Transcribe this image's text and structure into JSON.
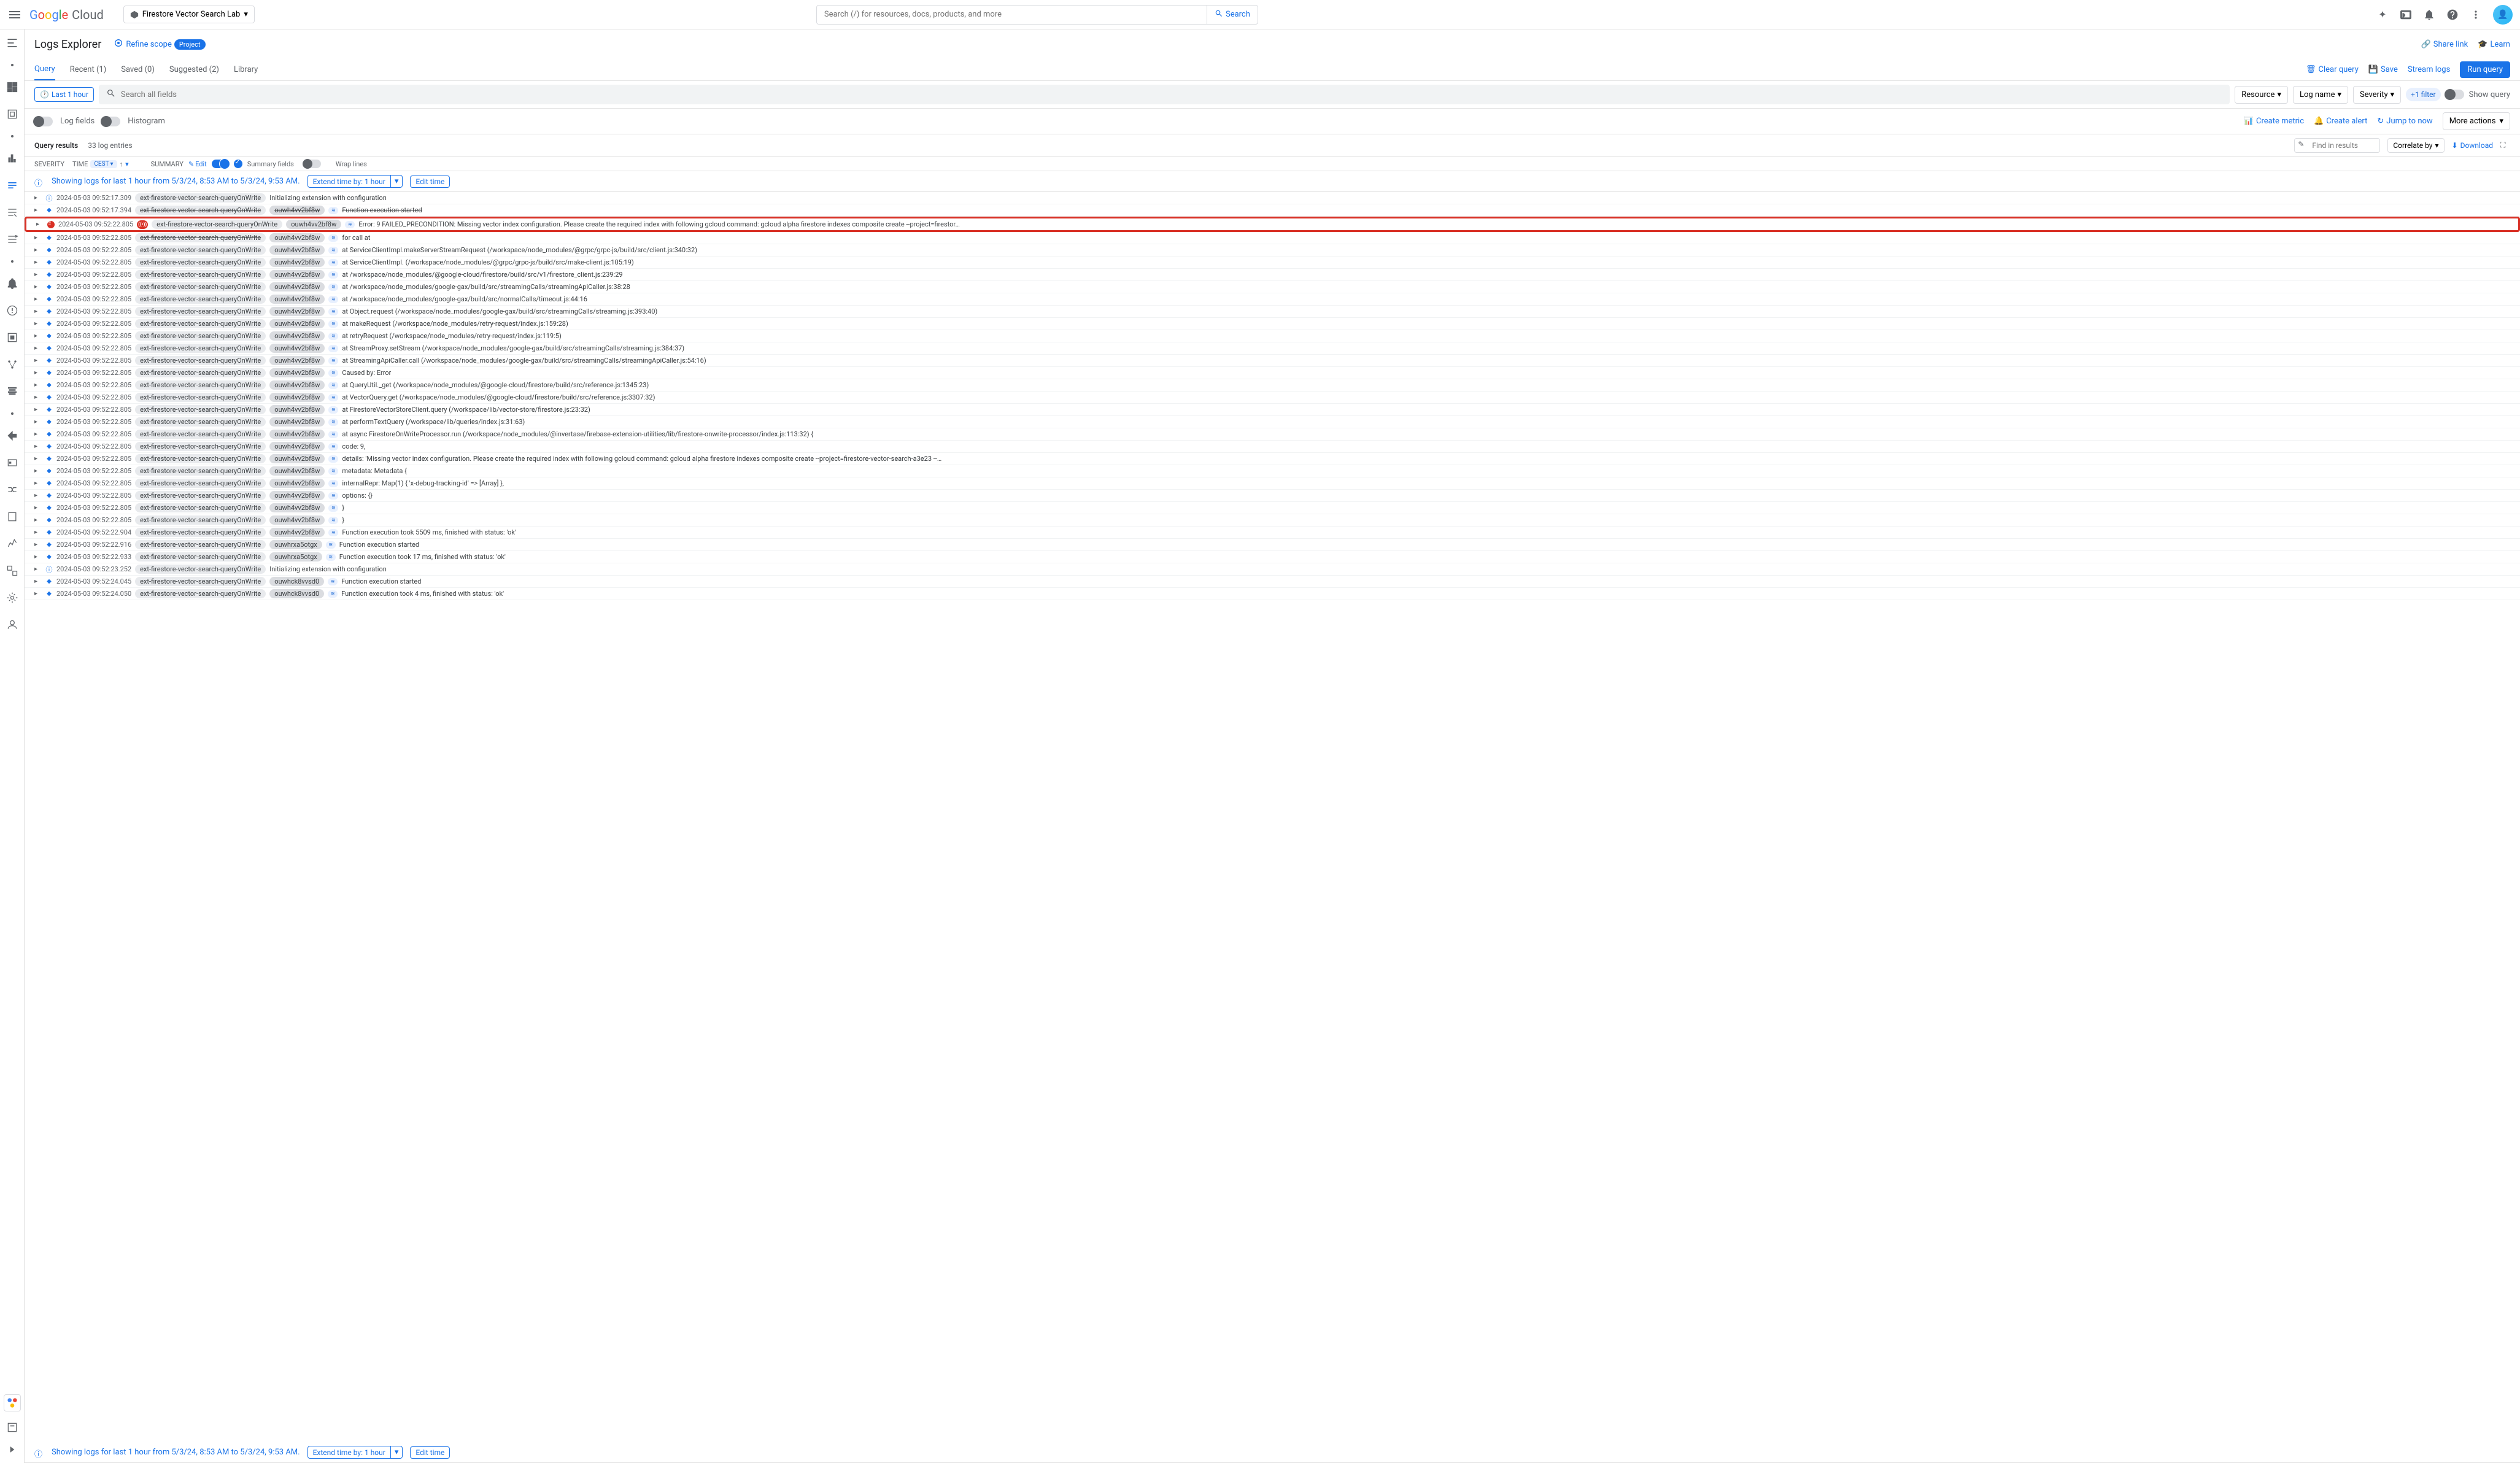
{
  "header": {
    "logo_cloud": "Cloud",
    "project_name": "Firestore Vector Search Lab",
    "search_placeholder": "Search (/) for resources, docs, products, and more",
    "search_button": "Search"
  },
  "title_bar": {
    "page_title": "Logs Explorer",
    "refine_scope": "Refine scope",
    "project_badge": "Project",
    "share_link": "Share link",
    "learn": "Learn"
  },
  "tabs": {
    "query": "Query",
    "recent": "Recent (1)",
    "saved": "Saved (0)",
    "suggested": "Suggested (2)",
    "library": "Library",
    "clear_query": "Clear query",
    "save": "Save",
    "stream_logs": "Stream logs",
    "run_query": "Run query"
  },
  "filter_bar": {
    "time_range": "Last 1 hour",
    "search_placeholder": "Search all fields",
    "resource": "Resource",
    "log_name": "Log name",
    "severity": "Severity",
    "plus_filter": "+1 filter",
    "show_query": "Show query"
  },
  "toggle_row": {
    "log_fields": "Log fields",
    "histogram": "Histogram",
    "create_metric": "Create metric",
    "create_alert": "Create alert",
    "jump_to_now": "Jump to now",
    "more_actions": "More actions"
  },
  "results_header": {
    "title": "Query results",
    "count": "33 log entries",
    "find_placeholder": "Find in results",
    "correlate": "Correlate by",
    "download": "Download"
  },
  "columns": {
    "severity": "SEVERITY",
    "time": "TIME",
    "timezone": "CEST",
    "summary": "SUMMARY",
    "edit": "Edit",
    "summary_fields": "Summary fields",
    "wrap_lines": "Wrap lines"
  },
  "info_bar": {
    "text": "Showing logs for last 1 hour from 5/3/24, 8:53 AM to 5/3/24, 9:53 AM.",
    "extend": "Extend time by: 1 hour",
    "edit_time": "Edit time"
  },
  "logs": [
    {
      "sev": "info",
      "ts": "2024-05-03 09:52:17.309",
      "func": "ext-firestore-vector-search-queryOnWrite",
      "id": "",
      "msg": "Initializing extension with configuration"
    },
    {
      "sev": "debug",
      "ts": "2024-05-03 09:52:17.394",
      "func": "ext-firestore-vector-search-queryOnWrite",
      "id": "ouwh4vv2bf8w",
      "msg": "Function execution started",
      "strike": true
    },
    {
      "sev": "error",
      "ts": "2024-05-03 09:52:22.805",
      "func": "ext-firestore-vector-search-queryOnWrite",
      "id": "ouwh4vv2bf8w",
      "msg": "Error: 9 FAILED_PRECONDITION: Missing vector index configuration. Please create the required index with following gcloud command: gcloud alpha firestore indexes composite create --project=firestor…",
      "highlight": true,
      "err_icon": true
    },
    {
      "sev": "debug",
      "ts": "2024-05-03 09:52:22.805",
      "func": "ext-firestore-vector-search-queryOnWrite",
      "id": "ouwh4vv2bf8w",
      "msg": "for call at",
      "strike_func": true
    },
    {
      "sev": "debug",
      "ts": "2024-05-03 09:52:22.805",
      "func": "ext-firestore-vector-search-queryOnWrite",
      "id": "ouwh4vv2bf8w",
      "msg": "    at ServiceClientImpl.makeServerStreamRequest (/workspace/node_modules/@grpc/grpc-js/build/src/client.js:340:32)"
    },
    {
      "sev": "debug",
      "ts": "2024-05-03 09:52:22.805",
      "func": "ext-firestore-vector-search-queryOnWrite",
      "id": "ouwh4vv2bf8w",
      "msg": "    at ServiceClientImpl.<anonymous> (/workspace/node_modules/@grpc/grpc-js/build/src/make-client.js:105:19)"
    },
    {
      "sev": "debug",
      "ts": "2024-05-03 09:52:22.805",
      "func": "ext-firestore-vector-search-queryOnWrite",
      "id": "ouwh4vv2bf8w",
      "msg": "    at /workspace/node_modules/@google-cloud/firestore/build/src/v1/firestore_client.js:239:29"
    },
    {
      "sev": "debug",
      "ts": "2024-05-03 09:52:22.805",
      "func": "ext-firestore-vector-search-queryOnWrite",
      "id": "ouwh4vv2bf8w",
      "msg": "    at /workspace/node_modules/google-gax/build/src/streamingCalls/streamingApiCaller.js:38:28"
    },
    {
      "sev": "debug",
      "ts": "2024-05-03 09:52:22.805",
      "func": "ext-firestore-vector-search-queryOnWrite",
      "id": "ouwh4vv2bf8w",
      "msg": "    at /workspace/node_modules/google-gax/build/src/normalCalls/timeout.js:44:16"
    },
    {
      "sev": "debug",
      "ts": "2024-05-03 09:52:22.805",
      "func": "ext-firestore-vector-search-queryOnWrite",
      "id": "ouwh4vv2bf8w",
      "msg": "    at Object.request (/workspace/node_modules/google-gax/build/src/streamingCalls/streaming.js:393:40)"
    },
    {
      "sev": "debug",
      "ts": "2024-05-03 09:52:22.805",
      "func": "ext-firestore-vector-search-queryOnWrite",
      "id": "ouwh4vv2bf8w",
      "msg": "    at makeRequest (/workspace/node_modules/retry-request/index.js:159:28)"
    },
    {
      "sev": "debug",
      "ts": "2024-05-03 09:52:22.805",
      "func": "ext-firestore-vector-search-queryOnWrite",
      "id": "ouwh4vv2bf8w",
      "msg": "    at retryRequest (/workspace/node_modules/retry-request/index.js:119:5)"
    },
    {
      "sev": "debug",
      "ts": "2024-05-03 09:52:22.805",
      "func": "ext-firestore-vector-search-queryOnWrite",
      "id": "ouwh4vv2bf8w",
      "msg": "    at StreamProxy.setStream (/workspace/node_modules/google-gax/build/src/streamingCalls/streaming.js:384:37)"
    },
    {
      "sev": "debug",
      "ts": "2024-05-03 09:52:22.805",
      "func": "ext-firestore-vector-search-queryOnWrite",
      "id": "ouwh4vv2bf8w",
      "msg": "    at StreamingApiCaller.call (/workspace/node_modules/google-gax/build/src/streamingCalls/streamingApiCaller.js:54:16)"
    },
    {
      "sev": "debug",
      "ts": "2024-05-03 09:52:22.805",
      "func": "ext-firestore-vector-search-queryOnWrite",
      "id": "ouwh4vv2bf8w",
      "msg": "Caused by: Error"
    },
    {
      "sev": "debug",
      "ts": "2024-05-03 09:52:22.805",
      "func": "ext-firestore-vector-search-queryOnWrite",
      "id": "ouwh4vv2bf8w",
      "msg": "    at QueryUtil._get (/workspace/node_modules/@google-cloud/firestore/build/src/reference.js:1345:23)"
    },
    {
      "sev": "debug",
      "ts": "2024-05-03 09:52:22.805",
      "func": "ext-firestore-vector-search-queryOnWrite",
      "id": "ouwh4vv2bf8w",
      "msg": "    at VectorQuery.get (/workspace/node_modules/@google-cloud/firestore/build/src/reference.js:3307:32)"
    },
    {
      "sev": "debug",
      "ts": "2024-05-03 09:52:22.805",
      "func": "ext-firestore-vector-search-queryOnWrite",
      "id": "ouwh4vv2bf8w",
      "msg": "    at FirestoreVectorStoreClient.query (/workspace/lib/vector-store/firestore.js:23:32)"
    },
    {
      "sev": "debug",
      "ts": "2024-05-03 09:52:22.805",
      "func": "ext-firestore-vector-search-queryOnWrite",
      "id": "ouwh4vv2bf8w",
      "msg": "    at performTextQuery (/workspace/lib/queries/index.js:31:63)"
    },
    {
      "sev": "debug",
      "ts": "2024-05-03 09:52:22.805",
      "func": "ext-firestore-vector-search-queryOnWrite",
      "id": "ouwh4vv2bf8w",
      "msg": "    at async FirestoreOnWriteProcessor.run (/workspace/node_modules/@invertase/firebase-extension-utilities/lib/firestore-onwrite-processor/index.js:113:32) {"
    },
    {
      "sev": "debug",
      "ts": "2024-05-03 09:52:22.805",
      "func": "ext-firestore-vector-search-queryOnWrite",
      "id": "ouwh4vv2bf8w",
      "msg": "  code: 9,"
    },
    {
      "sev": "debug",
      "ts": "2024-05-03 09:52:22.805",
      "func": "ext-firestore-vector-search-queryOnWrite",
      "id": "ouwh4vv2bf8w",
      "msg": "  details: 'Missing vector index configuration. Please create the required index with following gcloud command: gcloud alpha firestore indexes composite create --project=firestore-vector-search-a3e23 --…"
    },
    {
      "sev": "debug",
      "ts": "2024-05-03 09:52:22.805",
      "func": "ext-firestore-vector-search-queryOnWrite",
      "id": "ouwh4vv2bf8w",
      "msg": "  metadata: Metadata {"
    },
    {
      "sev": "debug",
      "ts": "2024-05-03 09:52:22.805",
      "func": "ext-firestore-vector-search-queryOnWrite",
      "id": "ouwh4vv2bf8w",
      "msg": "    internalRepr: Map(1) { 'x-debug-tracking-id' => [Array] },"
    },
    {
      "sev": "debug",
      "ts": "2024-05-03 09:52:22.805",
      "func": "ext-firestore-vector-search-queryOnWrite",
      "id": "ouwh4vv2bf8w",
      "msg": "    options: {}"
    },
    {
      "sev": "debug",
      "ts": "2024-05-03 09:52:22.805",
      "func": "ext-firestore-vector-search-queryOnWrite",
      "id": "ouwh4vv2bf8w",
      "msg": "  }"
    },
    {
      "sev": "debug",
      "ts": "2024-05-03 09:52:22.805",
      "func": "ext-firestore-vector-search-queryOnWrite",
      "id": "ouwh4vv2bf8w",
      "msg": "}"
    },
    {
      "sev": "debug",
      "ts": "2024-05-03 09:52:22.904",
      "func": "ext-firestore-vector-search-queryOnWrite",
      "id": "ouwh4vv2bf8w",
      "msg": "Function execution took 5509 ms, finished with status: 'ok'"
    },
    {
      "sev": "debug",
      "ts": "2024-05-03 09:52:22.916",
      "func": "ext-firestore-vector-search-queryOnWrite",
      "id": "ouwhrxa5otgx",
      "msg": "Function execution started"
    },
    {
      "sev": "debug",
      "ts": "2024-05-03 09:52:22.933",
      "func": "ext-firestore-vector-search-queryOnWrite",
      "id": "ouwhrxa5otgx",
      "msg": "Function execution took 17 ms, finished with status: 'ok'"
    },
    {
      "sev": "info",
      "ts": "2024-05-03 09:52:23.252",
      "func": "ext-firestore-vector-search-queryOnWrite",
      "id": "",
      "msg": "Initializing extension with configuration"
    },
    {
      "sev": "debug",
      "ts": "2024-05-03 09:52:24.045",
      "func": "ext-firestore-vector-search-queryOnWrite",
      "id": "ouwhck8vvsd0",
      "msg": "Function execution started"
    },
    {
      "sev": "debug",
      "ts": "2024-05-03 09:52:24.050",
      "func": "ext-firestore-vector-search-queryOnWrite",
      "id": "ouwhck8vvsd0",
      "msg": "Function execution took 4 ms, finished with status: 'ok'"
    }
  ]
}
